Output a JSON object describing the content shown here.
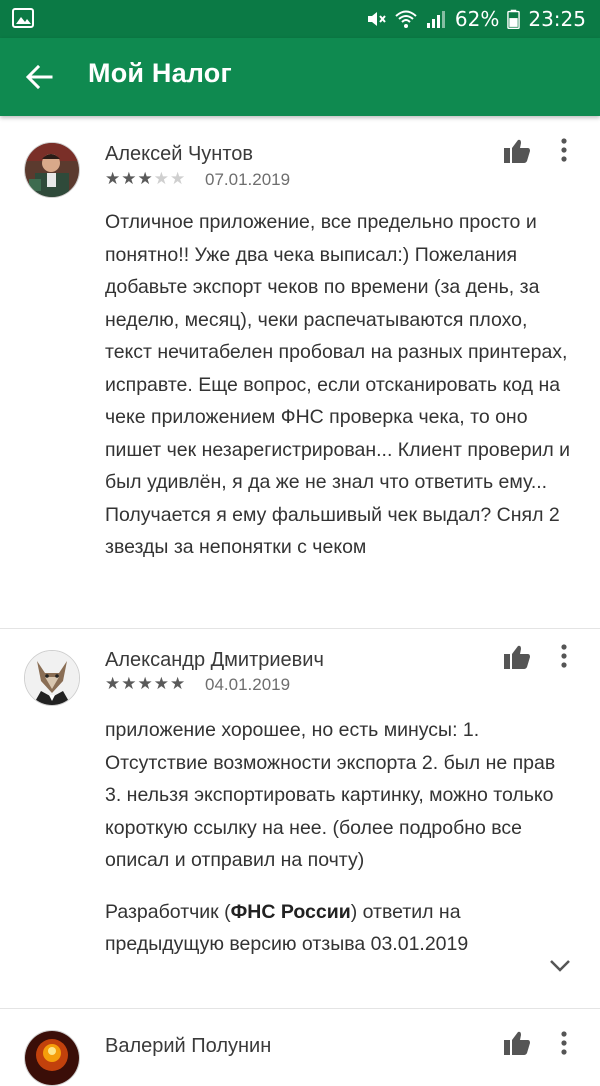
{
  "status_bar": {
    "battery": "62%",
    "time": "23:25",
    "icons": [
      "image-icon",
      "mute-icon",
      "wifi-icon",
      "signal-icon",
      "battery-icon"
    ]
  },
  "app_bar": {
    "title": "Мой Налог",
    "back_icon": "arrow-left-icon"
  },
  "reviews": [
    {
      "author": "Алексей Чунтов",
      "rating": 3,
      "stars": {
        "on": "★★★",
        "off": "★★"
      },
      "date": "07.01.2019",
      "text": "Отличное приложение, все предельно просто и понятно!! Уже два чека выписал:) Пожелания добавьте экспорт чеков по времени (за день, за неделю, месяц), чеки распечатываются плохо, текст нечитабелен пробовал на разных принтерах, исправте. Еще вопрос, если отсканировать код на чеке приложением ФНС проверка чека, то оно пишет чек незарегистрирован... Клиент проверил и был удивлён, я да же не знал что ответить ему... Получается я ему фальшивый чек выдал? Снял 2 звезды за непонятки с чеком"
    },
    {
      "author": "Александр Дмитриевич",
      "rating": 5,
      "stars": {
        "on": "★★★★★",
        "off": ""
      },
      "date": "04.01.2019",
      "text": "приложение хорошее, но есть минусы: 1. Отсутствие возможности экспорта 2. был не прав 3. нельзя экспортировать картинку, можно только короткую ссылку на нее. (более подробно все описал и отправил на почту)",
      "developer_reply": {
        "prefix": "Разработчик (",
        "developer": "ФНС России",
        "suffix": ") ответил на предыдущую версию отзыва 03.01.2019"
      }
    },
    {
      "author": "Валерий Полунин"
    }
  ]
}
